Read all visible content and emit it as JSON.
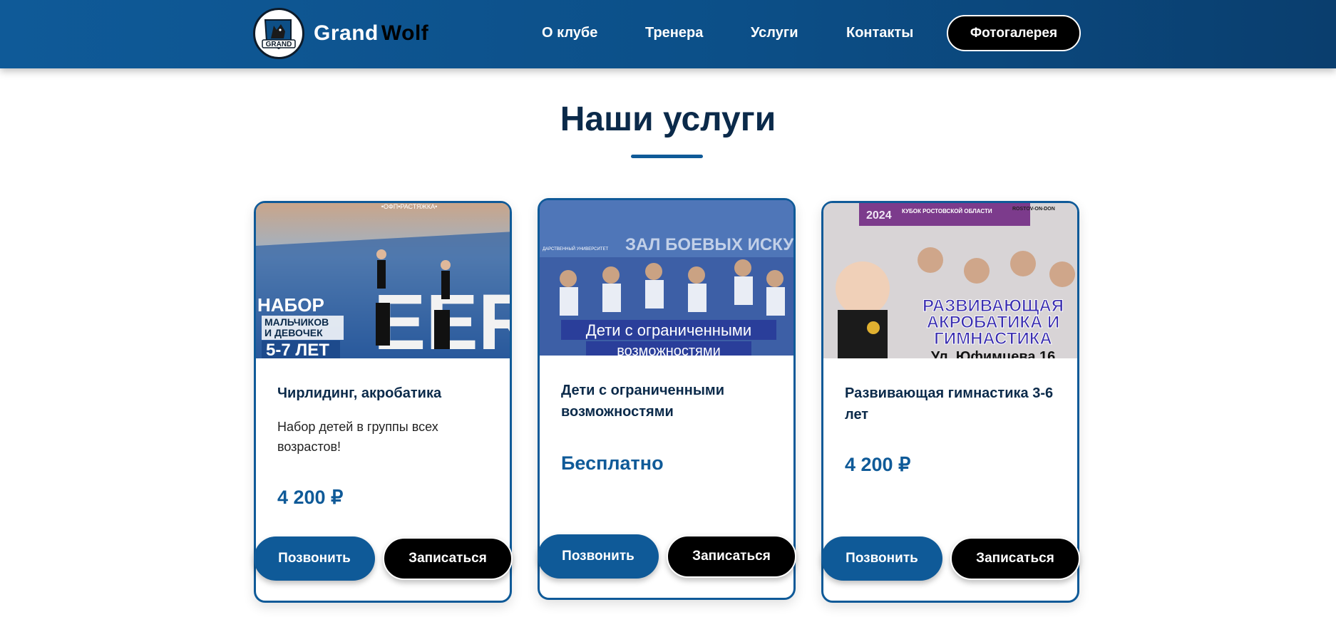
{
  "header": {
    "brand_first": "Grand",
    "brand_second": "Wolf",
    "logo_text": "GRAND",
    "nav": [
      "О клубе",
      "Тренера",
      "Услуги",
      "Контакты"
    ],
    "gallery_button": "Фотогалерея"
  },
  "section": {
    "title": "Наши услуги"
  },
  "cards": [
    {
      "image_tag": "•ОФП•РАСТЯЖКА•",
      "image_line1": "НАБОР",
      "image_line2": "МАЛЬЧИКОВ",
      "image_line3": "И ДЕВОЧЕК",
      "image_line4": "5-7 ЛЕТ",
      "image_word": "EER",
      "title": "Чирлидинг, акробатика",
      "description": "Набор детей в группы всех возрастов!",
      "price": "4 200 ₽",
      "call_label": "Позвонить",
      "book_label": "Записаться"
    },
    {
      "image_caption1": "Дети с ограниченными",
      "image_caption2": "возможностями",
      "image_bg_text": "ЗАЛ БОЕВЫХ ИСКУССТВ",
      "image_univ": "ДАРСТВЕННЫЙ УНИВЕРСИТЕТ",
      "title": "Дети с ограниченными возможностями",
      "price": "Бесплатно",
      "call_label": "Позвонить",
      "book_label": "Записаться"
    },
    {
      "image_banner": "КУБОК РОСТОВСКОЙ ОБЛАСТИ",
      "image_year": "2024",
      "image_city": "ROSTOV-ON-DON",
      "image_line1": "РАЗВИВАЮЩАЯ",
      "image_line2": "АКРОБАТИКА И",
      "image_line3": "ГИМНАСТИКА",
      "image_address": "Ул. Юфимцева 16",
      "title": "Развивающая гимнастика 3-6 лет",
      "price": "4 200 ₽",
      "call_label": "Позвонить",
      "book_label": "Записаться"
    }
  ],
  "colors": {
    "header_blue": "#0f5a98",
    "title_navy": "#0b2a4a",
    "button_black": "#000000"
  }
}
